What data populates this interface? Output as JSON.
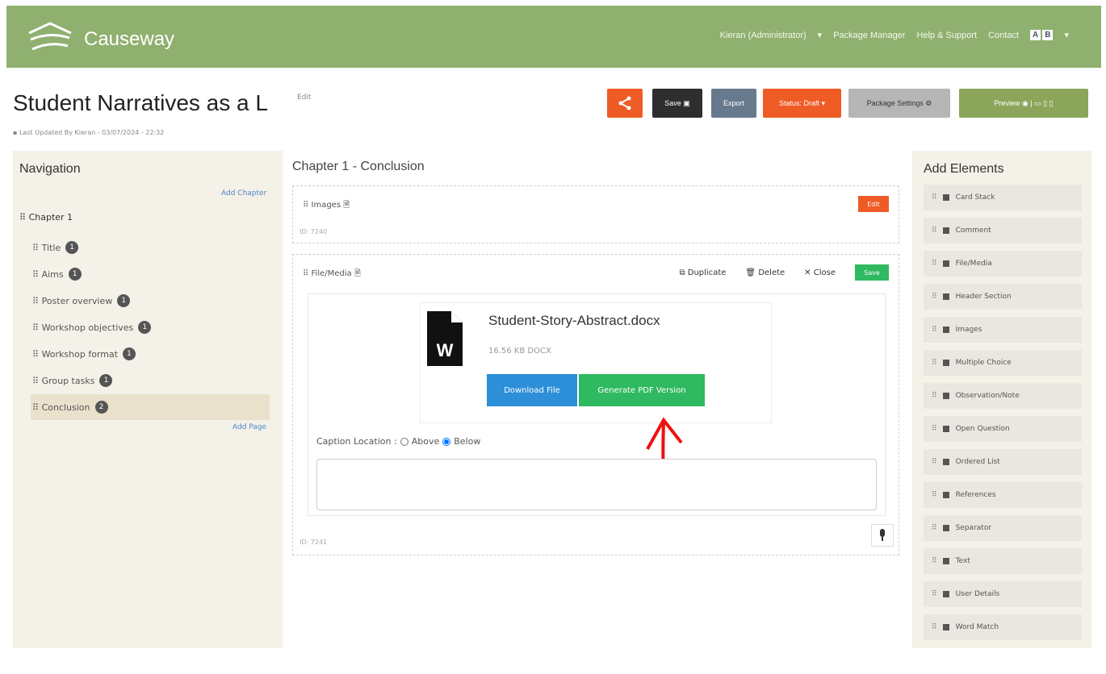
{
  "header": {
    "brand": "Causeway",
    "nav": [
      "Kieran (Administrator)",
      "Package Manager",
      "Help & Support",
      "Contact"
    ],
    "lang": [
      "A",
      "B"
    ],
    "colors": {
      "bar": "#8fb06f"
    }
  },
  "page": {
    "title": "Student Narratives as a L",
    "edit": "Edit",
    "updated": "Last Updated By Kieran - 03/07/2024 - 22:32"
  },
  "toolbar": {
    "save": "Save",
    "export": "Export",
    "status": "Status: Draft",
    "package_settings": "Package Settings",
    "preview": "Preview"
  },
  "navigation": {
    "title": "Navigation",
    "add_chapter": "Add Chapter",
    "chapter": "Chapter 1",
    "items": [
      {
        "label": "Title",
        "count": "1"
      },
      {
        "label": "Aims",
        "count": "1"
      },
      {
        "label": "Poster overview",
        "count": "1"
      },
      {
        "label": "Workshop objectives",
        "count": "1"
      },
      {
        "label": "Workshop format",
        "count": "1"
      },
      {
        "label": "Group tasks",
        "count": "1"
      },
      {
        "label": "Conclusion",
        "count": "2"
      }
    ],
    "add_page": "Add Page"
  },
  "main": {
    "title": "Chapter 1 - Conclusion",
    "card1": {
      "label": "Images",
      "id": "ID: 7240",
      "edit": "Edit"
    },
    "card2": {
      "label": "File/Media",
      "duplicate": "Duplicate",
      "delete": "Delete",
      "close": "Close",
      "save": "Save",
      "id": "ID: 7241",
      "file": {
        "name": "Student-Story-Abstract.docx",
        "meta": "16.56 KB DOCX",
        "download": "Download File",
        "generate": "Generate PDF Version"
      },
      "caption_label": "Caption Location :",
      "above": "Above",
      "below": "Below"
    }
  },
  "elements": {
    "title": "Add Elements",
    "items": [
      "Card Stack",
      "Comment",
      "File/Media",
      "Header Section",
      "Images",
      "Multiple Choice",
      "Observation/Note",
      "Open Question",
      "Ordered List",
      "References",
      "Separator",
      "Text",
      "User Details",
      "Word Match"
    ]
  }
}
